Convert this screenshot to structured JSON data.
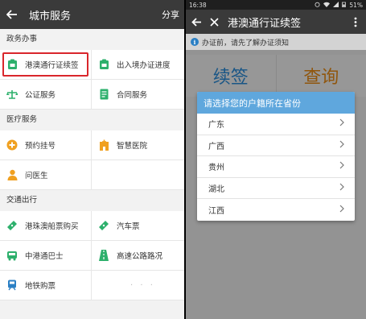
{
  "left": {
    "header": {
      "title": "城市服务",
      "share": "分享"
    },
    "sections": [
      {
        "title": "政务办事",
        "items": [
          {
            "label": "港澳通行证续签",
            "icon": "passport-icon",
            "color": "#2db06c",
            "highlight": true
          },
          {
            "label": "出入境办证进度",
            "icon": "passport-icon",
            "color": "#2db06c"
          },
          {
            "label": "公证服务",
            "icon": "scale-icon",
            "color": "#2db06c"
          },
          {
            "label": "合同服务",
            "icon": "document-icon",
            "color": "#2db06c"
          }
        ]
      },
      {
        "title": "医疗服务",
        "items": [
          {
            "label": "预约挂号",
            "icon": "medical-cross-icon",
            "color": "#f0a020"
          },
          {
            "label": "智慧医院",
            "icon": "hospital-icon",
            "color": "#f0a020"
          },
          {
            "label": "问医生",
            "icon": "doctor-icon",
            "color": "#f0a020"
          },
          {
            "label": "",
            "icon": "",
            "color": ""
          }
        ]
      },
      {
        "title": "交通出行",
        "items": [
          {
            "label": "港珠澳船票购买",
            "icon": "ticket-icon",
            "color": "#2db06c"
          },
          {
            "label": "汽车票",
            "icon": "ticket-icon",
            "color": "#2db06c"
          },
          {
            "label": "中港通巴士",
            "icon": "bus-icon",
            "color": "#2db06c"
          },
          {
            "label": "高速公路路况",
            "icon": "road-icon",
            "color": "#2db06c"
          },
          {
            "label": "地铁购票",
            "icon": "metro-icon",
            "color": "#2a7fc4"
          },
          {
            "label": "· · ·",
            "icon": "",
            "color": ""
          }
        ]
      }
    ]
  },
  "right": {
    "status": {
      "time": "16:38",
      "battery": "51%"
    },
    "header": {
      "title": "港澳通行证续签"
    },
    "notice": "办证前，请先了解办证须知",
    "buttons": {
      "renew": "续签",
      "query": "查询"
    },
    "dialog": {
      "title": "请选择您的户籍所在省份",
      "provinces": [
        "广东",
        "广西",
        "贵州",
        "湖北",
        "江西"
      ]
    }
  }
}
